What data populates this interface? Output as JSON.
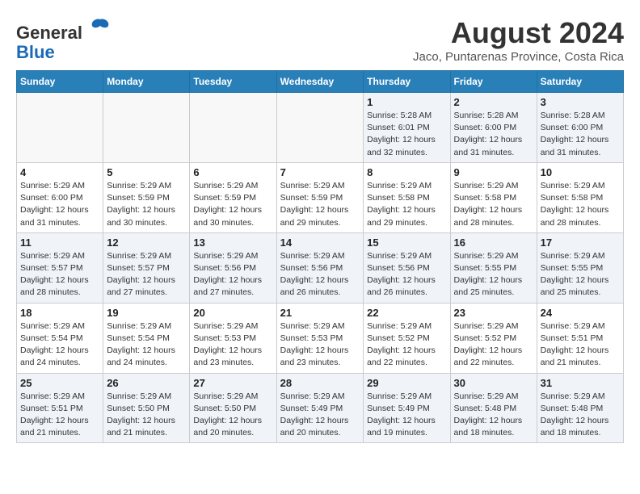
{
  "header": {
    "logo_line1": "General",
    "logo_line2": "Blue",
    "month_year": "August 2024",
    "location": "Jaco, Puntarenas Province, Costa Rica"
  },
  "weekdays": [
    "Sunday",
    "Monday",
    "Tuesday",
    "Wednesday",
    "Thursday",
    "Friday",
    "Saturday"
  ],
  "weeks": [
    [
      {
        "day": "",
        "info": ""
      },
      {
        "day": "",
        "info": ""
      },
      {
        "day": "",
        "info": ""
      },
      {
        "day": "",
        "info": ""
      },
      {
        "day": "1",
        "info": "Sunrise: 5:28 AM\nSunset: 6:01 PM\nDaylight: 12 hours\nand 32 minutes."
      },
      {
        "day": "2",
        "info": "Sunrise: 5:28 AM\nSunset: 6:00 PM\nDaylight: 12 hours\nand 31 minutes."
      },
      {
        "day": "3",
        "info": "Sunrise: 5:28 AM\nSunset: 6:00 PM\nDaylight: 12 hours\nand 31 minutes."
      }
    ],
    [
      {
        "day": "4",
        "info": "Sunrise: 5:29 AM\nSunset: 6:00 PM\nDaylight: 12 hours\nand 31 minutes."
      },
      {
        "day": "5",
        "info": "Sunrise: 5:29 AM\nSunset: 5:59 PM\nDaylight: 12 hours\nand 30 minutes."
      },
      {
        "day": "6",
        "info": "Sunrise: 5:29 AM\nSunset: 5:59 PM\nDaylight: 12 hours\nand 30 minutes."
      },
      {
        "day": "7",
        "info": "Sunrise: 5:29 AM\nSunset: 5:59 PM\nDaylight: 12 hours\nand 29 minutes."
      },
      {
        "day": "8",
        "info": "Sunrise: 5:29 AM\nSunset: 5:58 PM\nDaylight: 12 hours\nand 29 minutes."
      },
      {
        "day": "9",
        "info": "Sunrise: 5:29 AM\nSunset: 5:58 PM\nDaylight: 12 hours\nand 28 minutes."
      },
      {
        "day": "10",
        "info": "Sunrise: 5:29 AM\nSunset: 5:58 PM\nDaylight: 12 hours\nand 28 minutes."
      }
    ],
    [
      {
        "day": "11",
        "info": "Sunrise: 5:29 AM\nSunset: 5:57 PM\nDaylight: 12 hours\nand 28 minutes."
      },
      {
        "day": "12",
        "info": "Sunrise: 5:29 AM\nSunset: 5:57 PM\nDaylight: 12 hours\nand 27 minutes."
      },
      {
        "day": "13",
        "info": "Sunrise: 5:29 AM\nSunset: 5:56 PM\nDaylight: 12 hours\nand 27 minutes."
      },
      {
        "day": "14",
        "info": "Sunrise: 5:29 AM\nSunset: 5:56 PM\nDaylight: 12 hours\nand 26 minutes."
      },
      {
        "day": "15",
        "info": "Sunrise: 5:29 AM\nSunset: 5:56 PM\nDaylight: 12 hours\nand 26 minutes."
      },
      {
        "day": "16",
        "info": "Sunrise: 5:29 AM\nSunset: 5:55 PM\nDaylight: 12 hours\nand 25 minutes."
      },
      {
        "day": "17",
        "info": "Sunrise: 5:29 AM\nSunset: 5:55 PM\nDaylight: 12 hours\nand 25 minutes."
      }
    ],
    [
      {
        "day": "18",
        "info": "Sunrise: 5:29 AM\nSunset: 5:54 PM\nDaylight: 12 hours\nand 24 minutes."
      },
      {
        "day": "19",
        "info": "Sunrise: 5:29 AM\nSunset: 5:54 PM\nDaylight: 12 hours\nand 24 minutes."
      },
      {
        "day": "20",
        "info": "Sunrise: 5:29 AM\nSunset: 5:53 PM\nDaylight: 12 hours\nand 23 minutes."
      },
      {
        "day": "21",
        "info": "Sunrise: 5:29 AM\nSunset: 5:53 PM\nDaylight: 12 hours\nand 23 minutes."
      },
      {
        "day": "22",
        "info": "Sunrise: 5:29 AM\nSunset: 5:52 PM\nDaylight: 12 hours\nand 22 minutes."
      },
      {
        "day": "23",
        "info": "Sunrise: 5:29 AM\nSunset: 5:52 PM\nDaylight: 12 hours\nand 22 minutes."
      },
      {
        "day": "24",
        "info": "Sunrise: 5:29 AM\nSunset: 5:51 PM\nDaylight: 12 hours\nand 21 minutes."
      }
    ],
    [
      {
        "day": "25",
        "info": "Sunrise: 5:29 AM\nSunset: 5:51 PM\nDaylight: 12 hours\nand 21 minutes."
      },
      {
        "day": "26",
        "info": "Sunrise: 5:29 AM\nSunset: 5:50 PM\nDaylight: 12 hours\nand 21 minutes."
      },
      {
        "day": "27",
        "info": "Sunrise: 5:29 AM\nSunset: 5:50 PM\nDaylight: 12 hours\nand 20 minutes."
      },
      {
        "day": "28",
        "info": "Sunrise: 5:29 AM\nSunset: 5:49 PM\nDaylight: 12 hours\nand 20 minutes."
      },
      {
        "day": "29",
        "info": "Sunrise: 5:29 AM\nSunset: 5:49 PM\nDaylight: 12 hours\nand 19 minutes."
      },
      {
        "day": "30",
        "info": "Sunrise: 5:29 AM\nSunset: 5:48 PM\nDaylight: 12 hours\nand 18 minutes."
      },
      {
        "day": "31",
        "info": "Sunrise: 5:29 AM\nSunset: 5:48 PM\nDaylight: 12 hours\nand 18 minutes."
      }
    ]
  ]
}
